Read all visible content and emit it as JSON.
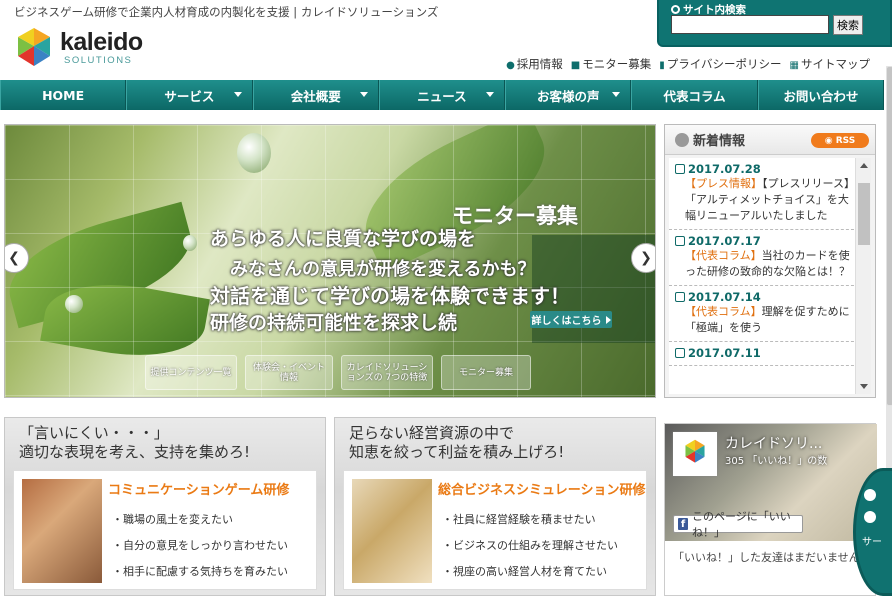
{
  "header": {
    "tagline": "ビジネスゲーム研修で企業内人材育成の内製化を支援 | カレイドソリューションズ",
    "logo_word": "kaleido",
    "logo_sub": "SOLUTIONS"
  },
  "search": {
    "title": "サイト内検索",
    "button": "検索"
  },
  "utility": [
    "採用情報",
    "モニター募集",
    "プライバシーポリシー",
    "サイトマップ"
  ],
  "nav": [
    {
      "label": "HOME"
    },
    {
      "label": "サービス"
    },
    {
      "label": "会社概要"
    },
    {
      "label": "ニュース"
    },
    {
      "label": "お客様の声"
    },
    {
      "label": "代表コラム"
    },
    {
      "label": "お問い合わせ"
    }
  ],
  "slider": {
    "line1": "あらゆる人に良質な学びの場を",
    "line2": "みなさんの意見が研修を変えるかも？",
    "line3": "対話を通じて学びの場を体験できます！",
    "line4": "研修の持続可能性を探求し続",
    "monitor_title": "モニター募集",
    "more_button": "詳しくはこちら",
    "thumbs": [
      "提供コンテンツ一覧",
      "体験会・イベント情報",
      "カレイドソリューションズの 7つの特徴",
      "モニター募集"
    ]
  },
  "news": {
    "title": "新着情報",
    "rss": "RSS",
    "items": [
      {
        "date": "2017.07.28",
        "category": "【プレス情報】",
        "text": "【プレスリリース】「アルティメットチョイス」を大幅リニューアルいたしました"
      },
      {
        "date": "2017.07.17",
        "category": "【代表コラム】",
        "text": "当社のカードを使った研修の致命的な欠陥とは！？"
      },
      {
        "date": "2017.07.14",
        "category": "【代表コラム】",
        "text": "理解を促すために「極端」を使う"
      },
      {
        "date": "2017.07.11",
        "category": "",
        "text": ""
      }
    ]
  },
  "promo1": {
    "head": "「言いにくい・・・」\n適切な表現を考え、支持を集めろ!",
    "title": "コミュニケーションゲーム研修",
    "items": [
      "職場の風土を変えたい",
      "自分の意見をしっかり言わせたい",
      "相手に配慮する気持ちを育みたい"
    ]
  },
  "promo2": {
    "head": "足らない経営資源の中で\n知恵を絞って利益を積み上げろ!",
    "title": "総合ビジネスシミュレーション研修",
    "items": [
      "社員に経営経験を積ませたい",
      "ビジネスの仕組みを理解させたい",
      "視座の高い経営人材を育てたい"
    ]
  },
  "facebook": {
    "page_name": "カレイドソリ...",
    "likes": "305 「いいね！」の数",
    "like_button": "このページに「いいね！」",
    "friends_text": "「いいね！」した友達はまだいません"
  },
  "side_widget": {
    "label": "サー"
  },
  "colors": {
    "teal": "#0f7472",
    "orange": "#ea7a14",
    "rss": "#f07b1c"
  }
}
